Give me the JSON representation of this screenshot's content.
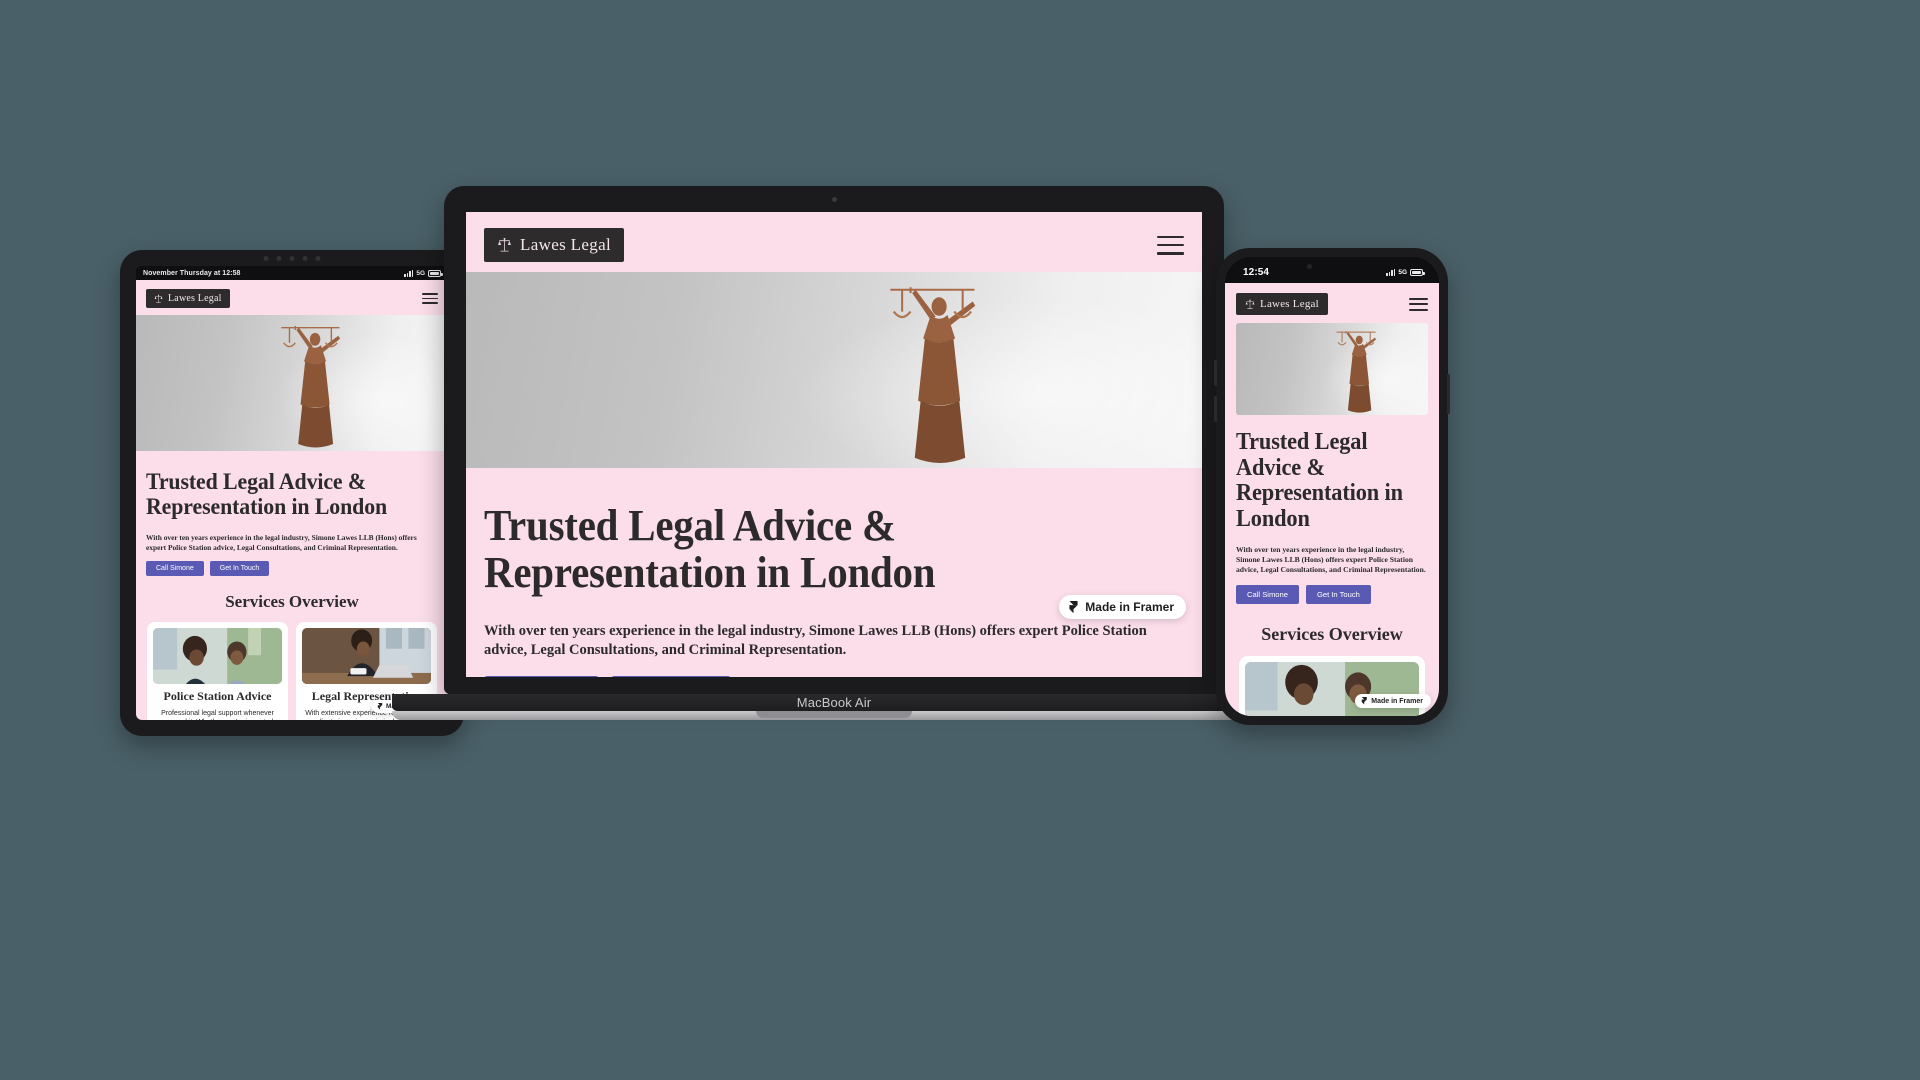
{
  "scene": {
    "background_color": "#4a6068",
    "devices": [
      "tablet",
      "laptop",
      "phone"
    ]
  },
  "brand": {
    "name": "Lawes Legal",
    "logo_icon": "scales-of-justice-icon",
    "chip_bg": "#2e2b2c",
    "chip_text_color": "#f5e6ee",
    "page_bg": "#fcdeeb",
    "accent_color": "#5a5ab4",
    "heading_color": "#2c2a2b"
  },
  "site": {
    "nav": {
      "menu_icon": "hamburger-menu-icon"
    },
    "hero": {
      "image_alt": "lady-justice-statue-with-scales",
      "heading": "Trusted Legal Advice & Representation in London",
      "paragraph": "With over ten years experience in the legal industry, Simone Lawes LLB (Hons) offers expert Police Station advice, Legal Consultations, and Criminal Representation.",
      "buttons": [
        {
          "label": "Call Simone",
          "name": "call-simone-button"
        },
        {
          "label": "Get In Touch",
          "name": "get-in-touch-button"
        }
      ]
    },
    "services": {
      "title": "Services Overview",
      "cards": [
        {
          "title": "Police Station Advice",
          "text": "Professional legal support whenever you need it. Whether you're in custody",
          "image_alt": "two-people-in-consultation"
        },
        {
          "title": "Legal Representation",
          "text": "With extensive experience representing clients in serious criminal cases, Simone",
          "image_alt": "lawyer-working-at-laptop"
        }
      ]
    },
    "badge": {
      "label": "Made in Framer",
      "icon": "framer-logo-icon"
    }
  },
  "laptop": {
    "device_label": "MacBook Air"
  },
  "tablet": {
    "status": {
      "time": "November Thursday at 12:58",
      "network": "5G"
    }
  },
  "phone": {
    "status": {
      "time": "12:54",
      "network": "5G"
    }
  }
}
